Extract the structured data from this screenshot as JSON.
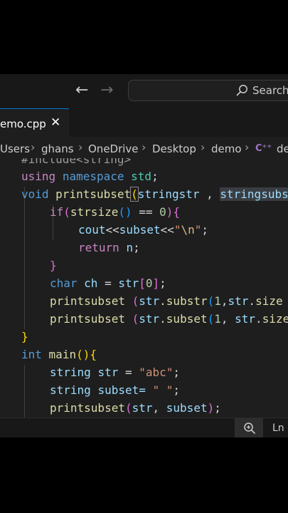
{
  "titlebar": {
    "search_placeholder": "Search",
    "back_arrow": "←",
    "forward_arrow": "→"
  },
  "tab": {
    "label": "emo.cpp",
    "close_glyph": "✕"
  },
  "breadcrumb": {
    "items": [
      "Users",
      "ghans",
      "OneDrive",
      "Desktop",
      "demo"
    ],
    "separator": "›",
    "file_icon": "C⁺⁺",
    "file_fragment": "de"
  },
  "code": {
    "include_line": "#include<string>",
    "l_using": "using",
    "l_namespace": "namespace",
    "l_std": "std",
    "l_void": "void",
    "l_printsubset": "printsubset",
    "l_stringstr": "stringstr",
    "l_stringsubset": "stringsubset",
    "l_if": "if",
    "l_strsize": "strsize",
    "l_zero": "0",
    "l_cout": "cout",
    "l_subset": "subset",
    "l_newline": "\\n",
    "l_return": "return",
    "l_n": "n",
    "l_char": "char",
    "l_ch": "ch",
    "l_str": "str",
    "l_substr": "substr",
    "l_one": "1",
    "l_size": "size",
    "l_int": "int",
    "l_main": "main",
    "l_string": "string",
    "l_abc": "\"abc\"",
    "l_space_str": "\" \"",
    "l_subset_eq": "subset="
  },
  "status": {
    "ln_label": "Ln"
  },
  "colors": {
    "background": "#1e1e1e",
    "keyword": "#569cd6",
    "control": "#c586c0",
    "function": "#dcdcaa",
    "type": "#4ec9b0",
    "variable": "#9cdcfe",
    "string": "#ce9178",
    "number": "#b5cea8",
    "accent": "#0078d4"
  }
}
